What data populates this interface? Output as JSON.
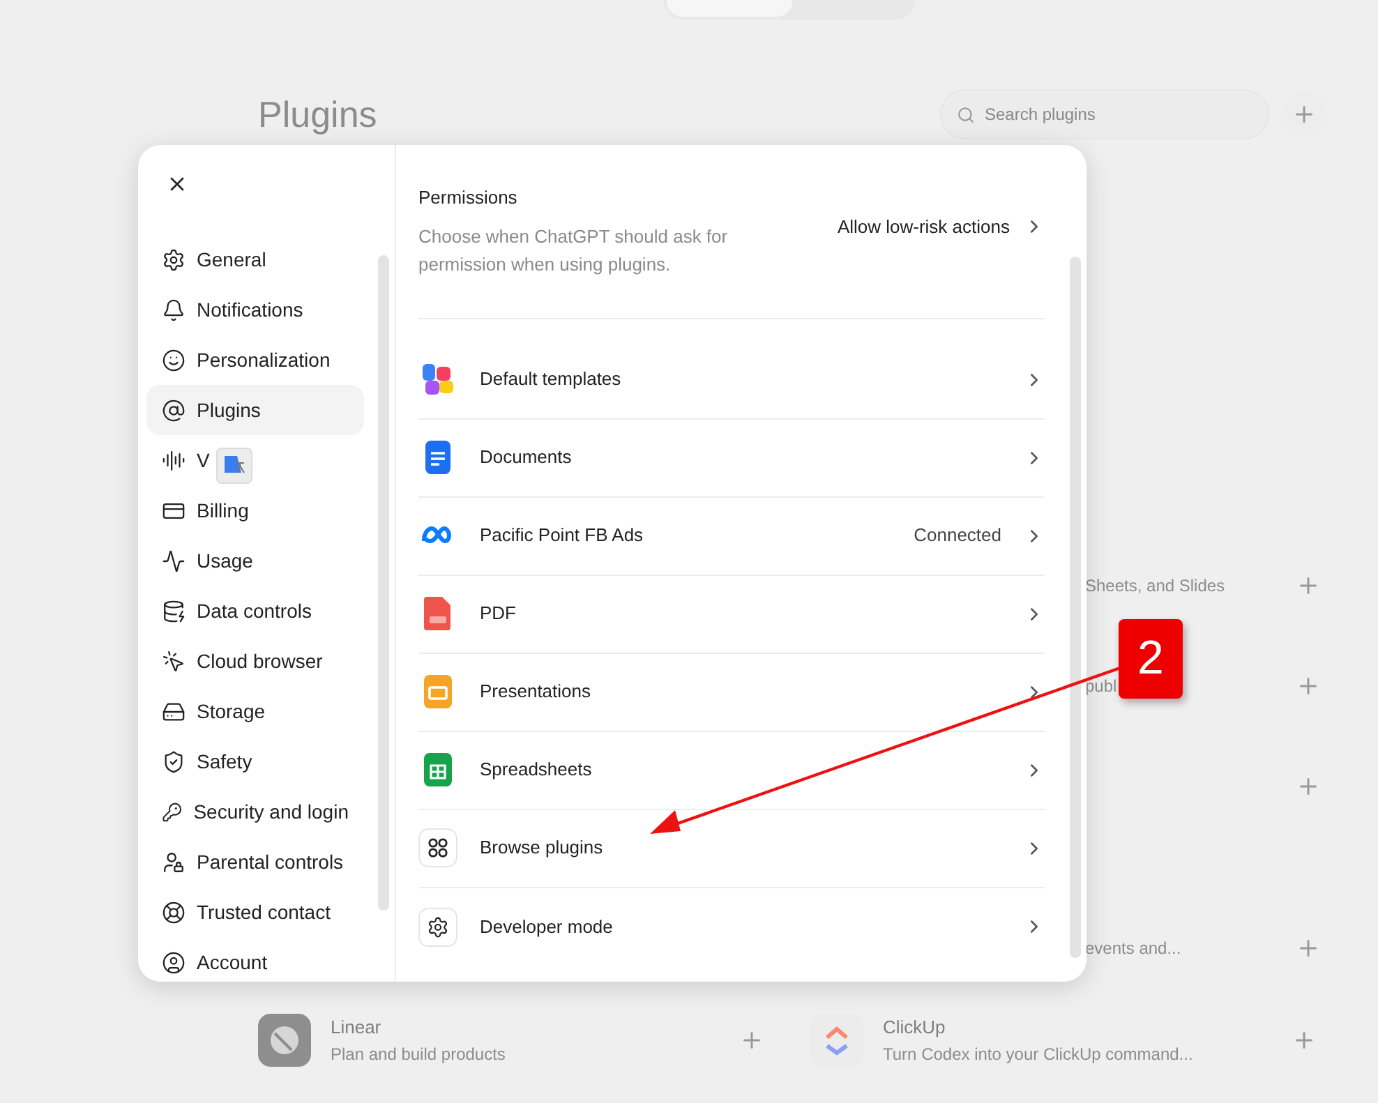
{
  "background": {
    "heading": "Plugins",
    "search": {
      "placeholder": "Search plugins"
    },
    "side_rows": [
      {
        "description": "Sheets, and Slides"
      },
      {
        "description": "publ"
      },
      {},
      {
        "description": "events and..."
      }
    ],
    "bottom_cards": [
      {
        "name": "Linear",
        "description": "Plan and build products"
      },
      {
        "name": "ClickUp",
        "description": "Turn Codex into your ClickUp command..."
      }
    ]
  },
  "settings": {
    "nav": [
      {
        "label": "General",
        "selected": false
      },
      {
        "label": "Notifications",
        "selected": false
      },
      {
        "label": "Personalization",
        "selected": false
      },
      {
        "label": "Plugins",
        "selected": true
      },
      {
        "label": "V",
        "selected": false
      },
      {
        "label": "Billing",
        "selected": false
      },
      {
        "label": "Usage",
        "selected": false
      },
      {
        "label": "Data controls",
        "selected": false
      },
      {
        "label": "Cloud browser",
        "selected": false
      },
      {
        "label": "Storage",
        "selected": false
      },
      {
        "label": "Safety",
        "selected": false
      },
      {
        "label": "Security and login",
        "selected": false
      },
      {
        "label": "Parental controls",
        "selected": false
      },
      {
        "label": "Trusted contact",
        "selected": false
      },
      {
        "label": "Account",
        "selected": false
      }
    ],
    "permissions": {
      "title": "Permissions",
      "description": "Choose when ChatGPT should ask for permission when using plugins.",
      "value": "Allow low-risk actions"
    },
    "plugins": [
      {
        "name": "Default templates"
      },
      {
        "name": "Documents"
      },
      {
        "name": "Pacific Point FB Ads",
        "status": "Connected"
      },
      {
        "name": "PDF"
      },
      {
        "name": "Presentations"
      },
      {
        "name": "Spreadsheets"
      },
      {
        "name": "Browse plugins"
      },
      {
        "name": "Developer mode"
      }
    ]
  },
  "annotation": {
    "label": "2"
  }
}
